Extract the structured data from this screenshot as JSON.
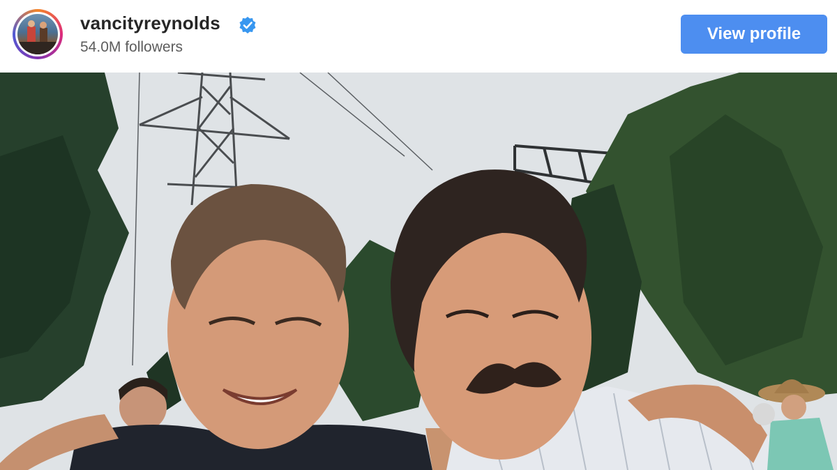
{
  "header": {
    "username": "vancityreynolds",
    "followers": "54.0M followers",
    "view_profile_label": "View profile",
    "verified_icon": "verified-badge-icon"
  },
  "colors": {
    "button_bg": "#4d8ef0",
    "verified": "#3897f0",
    "username": "#262626",
    "followers": "#5d5d5d"
  },
  "post": {
    "image_content": "photo"
  }
}
